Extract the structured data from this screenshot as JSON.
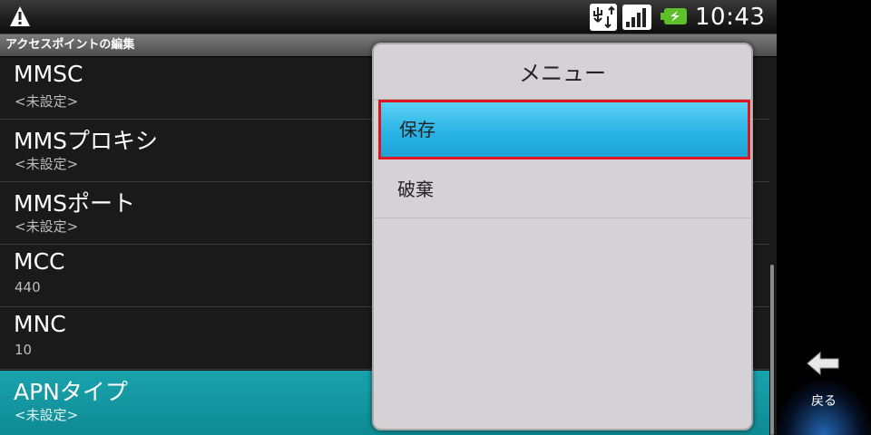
{
  "status_bar": {
    "time": "10:43",
    "icons": [
      "warning-icon",
      "usb-debug-icon",
      "signal-icon",
      "battery-charging-icon"
    ]
  },
  "screen": {
    "title": "アクセスポイントの編集"
  },
  "list": {
    "items": [
      {
        "title": "MMSC",
        "value": "<未設定>"
      },
      {
        "title": "MMSプロキシ",
        "value": "<未設定>"
      },
      {
        "title": "MMSポート",
        "value": "<未設定>"
      },
      {
        "title": "MCC",
        "value": "440"
      },
      {
        "title": "MNC",
        "value": "10"
      },
      {
        "title": "APNタイプ",
        "value": "<未設定>"
      }
    ]
  },
  "menu": {
    "title": "メニュー",
    "items": [
      {
        "label": "保存"
      },
      {
        "label": "破棄"
      }
    ]
  },
  "nav": {
    "back_label": "戻る"
  },
  "colors": {
    "selected_row": "#1aa3ad",
    "menu_highlight": "#29b4e6",
    "highlight_border": "#e0151f",
    "dialog_bg": "#d4d2d4"
  }
}
